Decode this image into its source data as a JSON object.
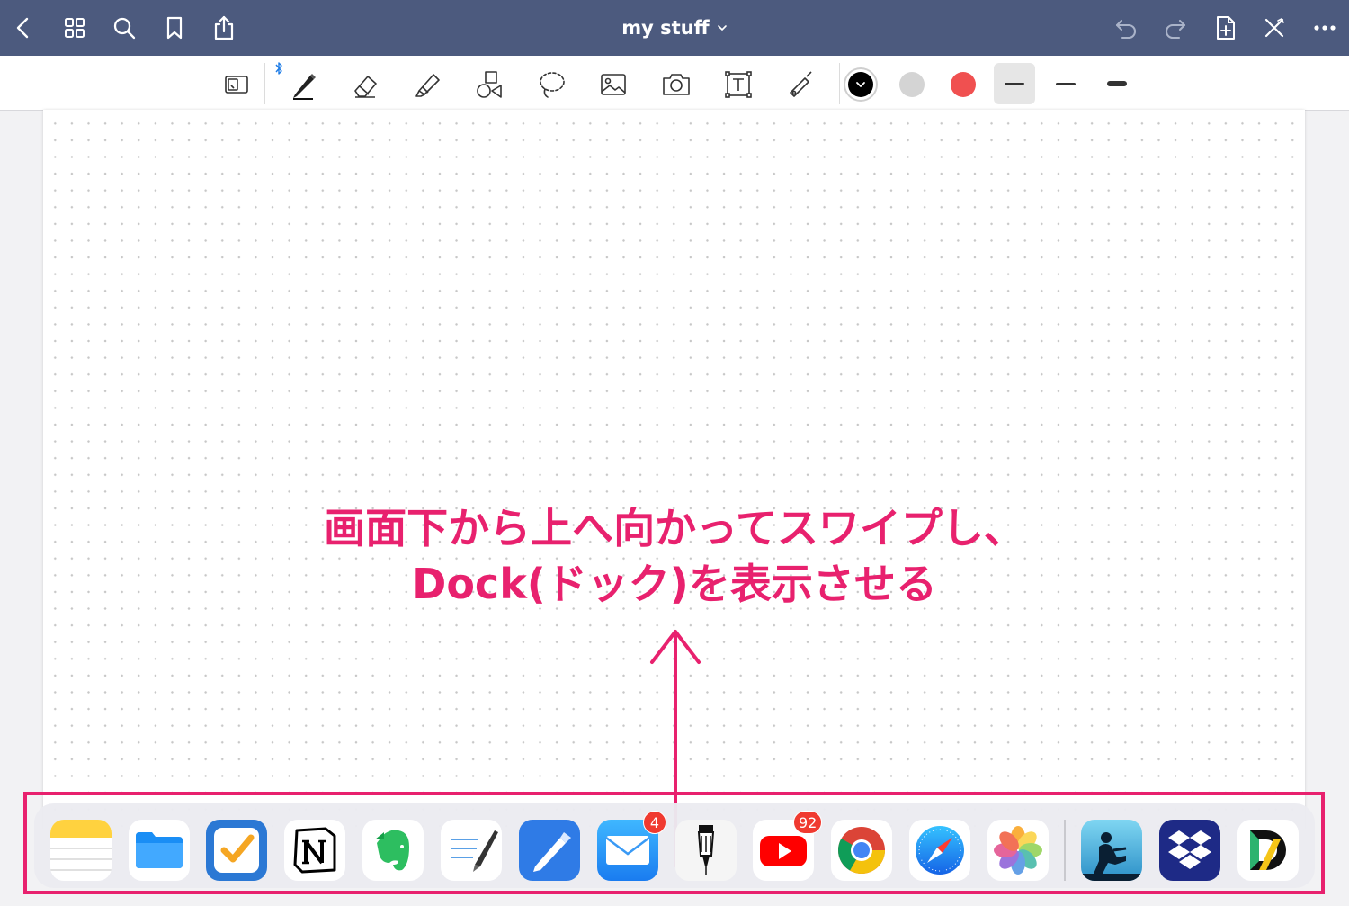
{
  "navbar": {
    "title": "my stuff",
    "background": "#4c5a7e",
    "left_buttons": [
      "back-icon",
      "grid-icon",
      "search-icon",
      "bookmark-icon",
      "share-icon"
    ],
    "right_buttons": [
      "undo-icon",
      "redo-icon",
      "add-page-icon",
      "close-icon",
      "more-icon"
    ]
  },
  "toolbar": {
    "tools": [
      "read-mode-icon",
      "bluetooth-icon",
      "pen-icon",
      "eraser-icon",
      "highlighter-icon",
      "shapes-icon",
      "lasso-icon",
      "image-icon",
      "camera-icon",
      "textbox-icon",
      "laser-pointer-icon"
    ],
    "colors": [
      "#000000",
      "#d4d4d4",
      "#f05050"
    ],
    "selected_color": "#000000",
    "stroke_widths": [
      "thin",
      "medium",
      "thick"
    ],
    "selected_stroke": "thin"
  },
  "annotation": {
    "line1": "画面下から上へ向かってスワイプし、",
    "line2": "Dock(ドック)を表示させる",
    "color": "#e8216e"
  },
  "dock": {
    "apps": [
      {
        "name": "notes-app-icon"
      },
      {
        "name": "files-app-icon"
      },
      {
        "name": "omnifocus-app-icon"
      },
      {
        "name": "notion-app-icon"
      },
      {
        "name": "evernote-app-icon"
      },
      {
        "name": "goodnotes-app-icon"
      },
      {
        "name": "pen-app-icon"
      },
      {
        "name": "mail-app-icon",
        "badge": "4"
      },
      {
        "name": "marker-app-icon"
      },
      {
        "name": "youtube-app-icon",
        "badge": "92"
      },
      {
        "name": "chrome-app-icon"
      },
      {
        "name": "safari-app-icon"
      },
      {
        "name": "photos-app-icon"
      },
      {
        "name": "kindle-app-icon"
      },
      {
        "name": "dropbox-app-icon"
      },
      {
        "name": "documents-app-icon"
      }
    ],
    "highlight_color": "#e8216e"
  }
}
